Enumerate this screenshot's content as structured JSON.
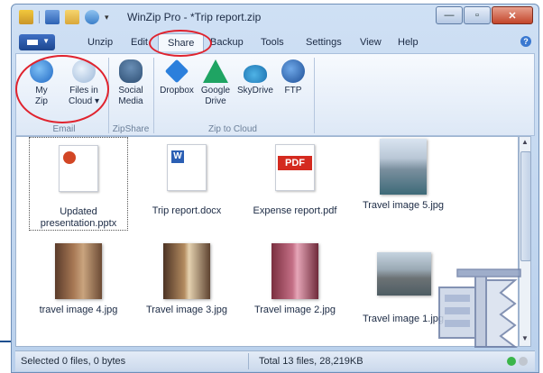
{
  "window": {
    "title": "WinZip Pro - *Trip report.zip",
    "controls": {
      "minimize": "—",
      "maximize": "▫",
      "close": "✕"
    }
  },
  "menu": {
    "tabs": [
      {
        "label": "Unzip"
      },
      {
        "label": "Edit"
      },
      {
        "label": "Share",
        "active": true
      },
      {
        "label": "Backup"
      },
      {
        "label": "Tools"
      },
      {
        "label": "Settings"
      },
      {
        "label": "View"
      },
      {
        "label": "Help"
      }
    ],
    "help_glyph": "?"
  },
  "ribbon": {
    "groups": [
      {
        "label": "Email",
        "buttons": [
          {
            "label_line1": "My",
            "label_line2": "Zip",
            "icon": "cloud-upload-icon"
          },
          {
            "label_line1": "Files in",
            "label_line2": "Cloud ▾",
            "icon": "cloud-files-icon"
          }
        ]
      },
      {
        "label": "ZipShare",
        "buttons": [
          {
            "label_line1": "Social",
            "label_line2": "Media",
            "icon": "people-icon"
          }
        ]
      },
      {
        "label": "Zip to Cloud",
        "buttons": [
          {
            "label_line1": "Dropbox",
            "label_line2": "",
            "icon": "dropbox-icon"
          },
          {
            "label_line1": "Google",
            "label_line2": "Drive",
            "icon": "google-drive-icon"
          },
          {
            "label_line1": "SkyDrive",
            "label_line2": "",
            "icon": "skydrive-icon"
          },
          {
            "label_line1": "FTP",
            "label_line2": "",
            "icon": "ftp-icon"
          }
        ]
      }
    ]
  },
  "files": [
    {
      "name_line1": "Updated",
      "name_line2": "presentation.pptx",
      "kind": "pptx"
    },
    {
      "name_line1": "Trip report.docx",
      "name_line2": "",
      "kind": "docx"
    },
    {
      "name_line1": "Expense report.pdf",
      "name_line2": "",
      "kind": "pdf"
    },
    {
      "name_line1": "Travel image 5.jpg",
      "name_line2": "",
      "kind": "photo"
    },
    {
      "name_line1": "travel image 4.jpg",
      "name_line2": "",
      "kind": "photo"
    },
    {
      "name_line1": "Travel image 3.jpg",
      "name_line2": "",
      "kind": "photo"
    },
    {
      "name_line1": "Travel image 2.jpg",
      "name_line2": "",
      "kind": "photo"
    },
    {
      "name_line1": "Travel image 1.jpg",
      "name_line2": "",
      "kind": "photo"
    }
  ],
  "status": {
    "selected": "Selected 0 files, 0 bytes",
    "total": "Total 13 files, 28,219KB"
  },
  "colors": {
    "accent": "#1c468f",
    "highlight_oval": "#e0232e",
    "status_green": "#3bb54a",
    "status_gray": "#c0c6cf"
  }
}
